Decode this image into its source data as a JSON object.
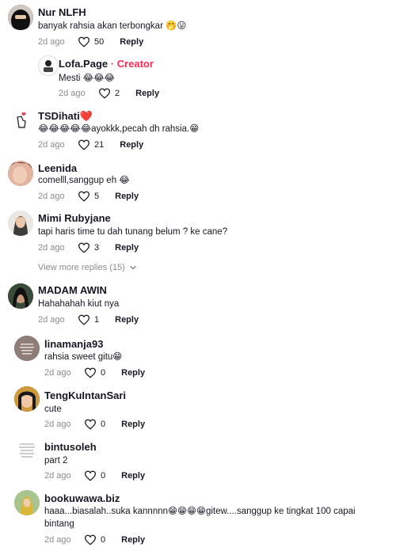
{
  "comments": [
    {
      "user": "Nur NLFH",
      "text": "banyak rahsia akan terbongkar 🤭😛",
      "date": "2d ago",
      "likes": "50",
      "reply": "Reply"
    },
    {
      "user": "Lofa.Page",
      "creator_sep": " · ",
      "creator_label": "Creator",
      "text": "Mesti 😂😂😂",
      "date": "2d ago",
      "likes": "2",
      "reply": "Reply"
    },
    {
      "user": "TSDihati❤️",
      "text": "😂😂😂😂😂ayokkk,pecah dh rahsia.😁",
      "date": "2d ago",
      "likes": "21",
      "reply": "Reply"
    },
    {
      "user": "Leenida",
      "text": "comelll,sanggup eh 😂",
      "date": "2d ago",
      "likes": "5",
      "reply": "Reply"
    },
    {
      "user": "Mimi Rubyjane",
      "text": "tapi haris time tu dah tunang belum ? ke cane?",
      "date": "2d ago",
      "likes": "3",
      "reply": "Reply"
    },
    {
      "user": "MADAM AWIN",
      "text": "Hahahahah kiut nya",
      "date": "2d ago",
      "likes": "1",
      "reply": "Reply"
    },
    {
      "user": "linamanja93",
      "text": "rahsia sweet gitu😁",
      "date": "2d ago",
      "likes": "0",
      "reply": "Reply"
    },
    {
      "user": "TengKuIntanSari",
      "text": "cute",
      "date": "2d ago",
      "likes": "0",
      "reply": "Reply"
    },
    {
      "user": "bintusoleh",
      "text": "part 2",
      "date": "2d ago",
      "likes": "0",
      "reply": "Reply"
    },
    {
      "user": "bookuwawa.biz",
      "text": "haaa...biasalah..suka kannnnn😁😁😁😁gitew....sanggup ke tingkat 100 capai bintang",
      "date": "2d ago",
      "likes": "0",
      "reply": "Reply"
    }
  ],
  "view_more": "View more replies (15)",
  "icons": {
    "like": "heart-outline-icon",
    "view_more": "chevron-down-icon"
  },
  "colors": {
    "creator": "#fe2c55",
    "muted": "#8a8b91",
    "text": "#161823"
  }
}
